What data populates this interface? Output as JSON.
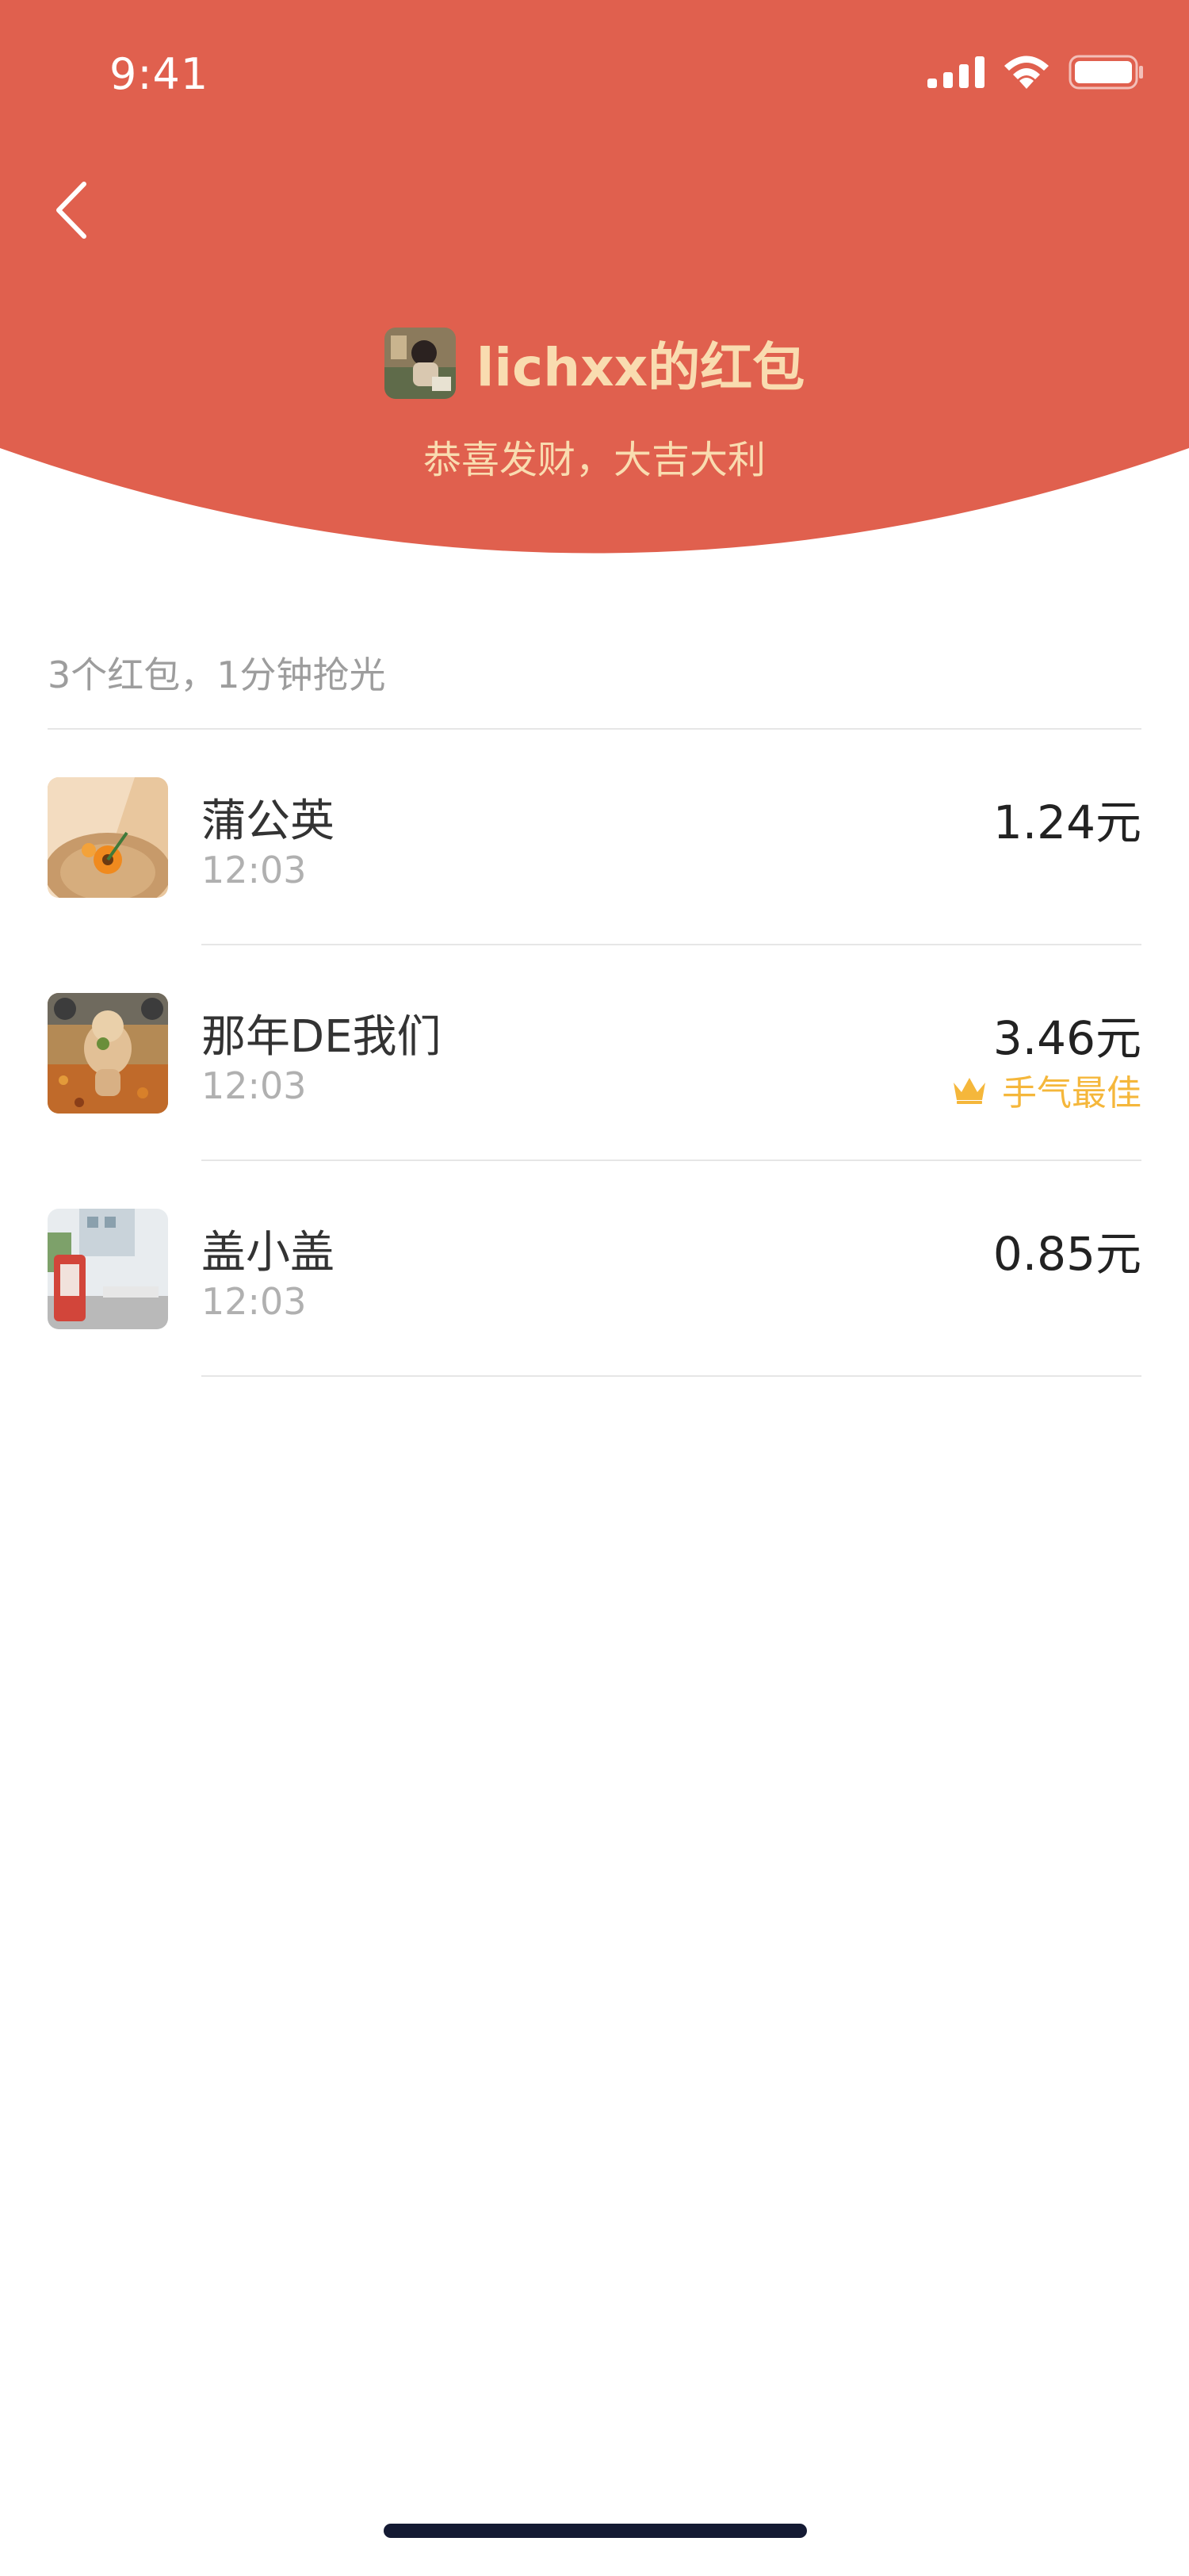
{
  "status_bar": {
    "time": "9:41"
  },
  "header": {
    "title": "lichxx的红包",
    "subtitle": "恭喜发财，大吉大利",
    "background_color": "#e0604e",
    "text_color": "#f9dcb0"
  },
  "summary": "3个红包，1分钟抢光",
  "list": [
    {
      "name": "蒲公英",
      "time": "12:03",
      "amount": "1.24元"
    },
    {
      "name": "那年DE我们",
      "time": "12:03",
      "amount": "3.46元",
      "badge": "手气最佳"
    },
    {
      "name": "盖小盖",
      "time": "12:03",
      "amount": "0.85元"
    }
  ]
}
